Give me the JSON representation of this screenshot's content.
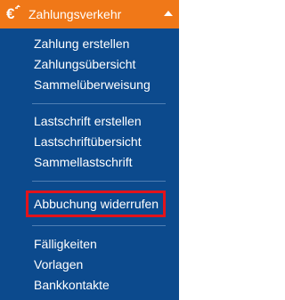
{
  "header": {
    "title": "Zahlungsverkehr",
    "icon": "euro-transfer-icon",
    "caret": "caret-up-icon",
    "accent_color": "#f07818"
  },
  "groups": [
    {
      "items": [
        {
          "label": "Zahlung erstellen"
        },
        {
          "label": "Zahlungsübersicht"
        },
        {
          "label": "Sammelüberweisung"
        }
      ]
    },
    {
      "items": [
        {
          "label": "Lastschrift erstellen"
        },
        {
          "label": "Lastschriftübersicht"
        },
        {
          "label": "Sammellastschrift"
        }
      ]
    },
    {
      "items": [
        {
          "label": "Abbuchung widerrufen",
          "highlighted": true
        }
      ]
    },
    {
      "items": [
        {
          "label": "Fälligkeiten"
        },
        {
          "label": "Vorlagen"
        },
        {
          "label": "Bankkontakte"
        }
      ]
    }
  ],
  "colors": {
    "background": "#0c4a8d",
    "text": "#ffffff",
    "divider": "#4f7fb4",
    "highlight_border": "#e3131b"
  }
}
